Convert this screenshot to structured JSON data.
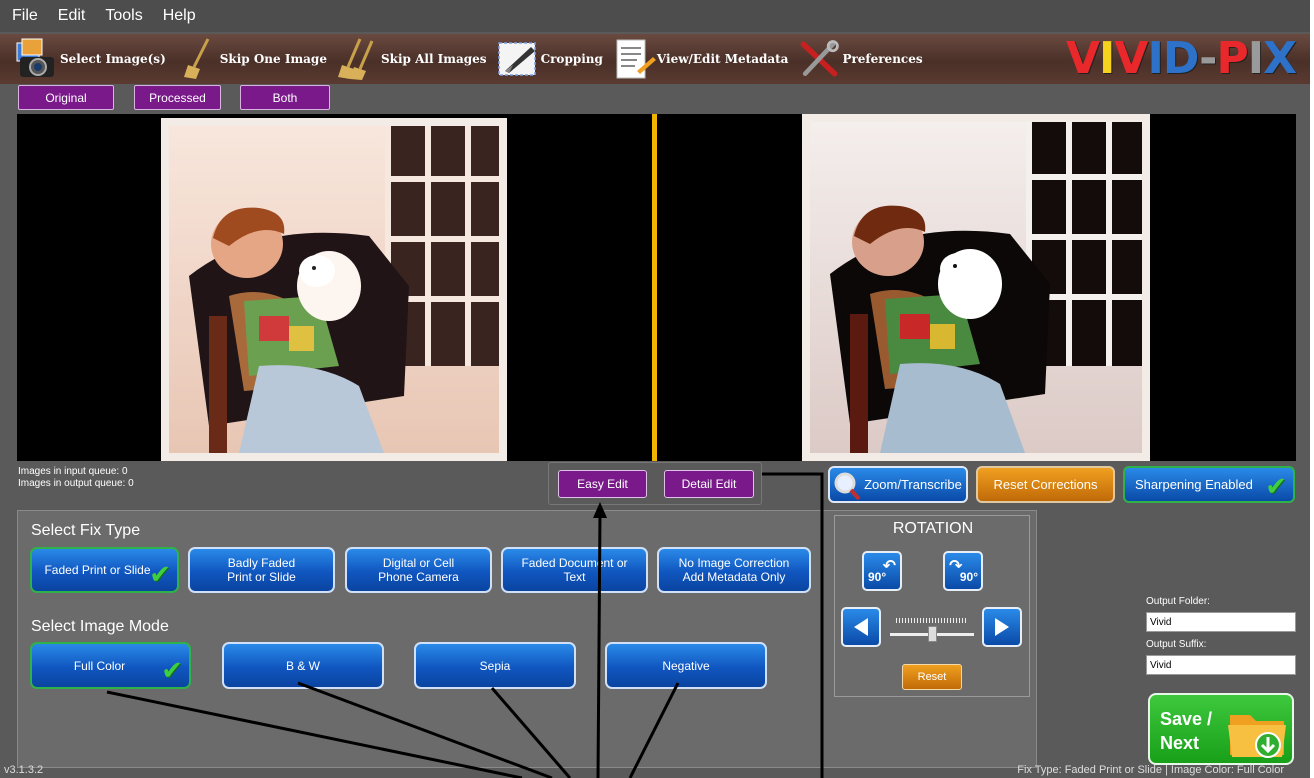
{
  "menu": [
    "File",
    "Edit",
    "Tools",
    "Help"
  ],
  "toolbar": {
    "select_images": "Select Image(s)",
    "skip_one": "Skip One Image",
    "skip_all": "Skip All Images",
    "cropping": "Cropping",
    "metadata": "View/Edit Metadata",
    "preferences": "Preferences"
  },
  "logo": {
    "text": "VIVID-PIX",
    "colors": [
      "#e8282a",
      "#f4d21e",
      "#e8282a",
      "#2d72c8",
      "#2d72c8",
      "#9a9a9a",
      "#e8282a",
      "#9a9a9a",
      "#2d72c8"
    ]
  },
  "view": {
    "original": "Original",
    "processed": "Processed",
    "both": "Both"
  },
  "queue": {
    "input": "Images in input queue:  0",
    "output": "Images in output queue: 0"
  },
  "edit": {
    "easy": "Easy Edit",
    "detail": "Detail Edit"
  },
  "actions": {
    "zoom": "Zoom/Transcribe",
    "reset_corrections": "Reset Corrections",
    "sharpening": "Sharpening Enabled"
  },
  "fix_type": {
    "title": "Select Fix Type",
    "options": [
      {
        "label": "Faded Print or Slide",
        "selected": true
      },
      {
        "label": "Badly Faded\nPrint or Slide",
        "selected": false
      },
      {
        "label": "Digital or Cell\nPhone Camera",
        "selected": false
      },
      {
        "label": "Faded Document or\nText",
        "selected": false
      },
      {
        "label": "No Image Correction\nAdd Metadata Only",
        "selected": false
      }
    ]
  },
  "image_mode": {
    "title": "Select Image Mode",
    "options": [
      {
        "label": "Full Color",
        "selected": true
      },
      {
        "label": "B & W",
        "selected": false
      },
      {
        "label": "Sepia",
        "selected": false
      },
      {
        "label": "Negative",
        "selected": false
      }
    ]
  },
  "rotation": {
    "title": "ROTATION",
    "left_label": "90°",
    "right_label": "90°",
    "reset": "Reset",
    "slider_value": 0.5
  },
  "output": {
    "folder_label": "Output Folder:",
    "folder_value": "Vivid",
    "suffix_label": "Output Suffix:",
    "suffix_value": "Vivid"
  },
  "save": {
    "line1": "Save /",
    "line2": "Next"
  },
  "version": "v3.1.3.2",
  "status": "Fix Type:  Faded Print or Slide | Image Color: Full Color"
}
